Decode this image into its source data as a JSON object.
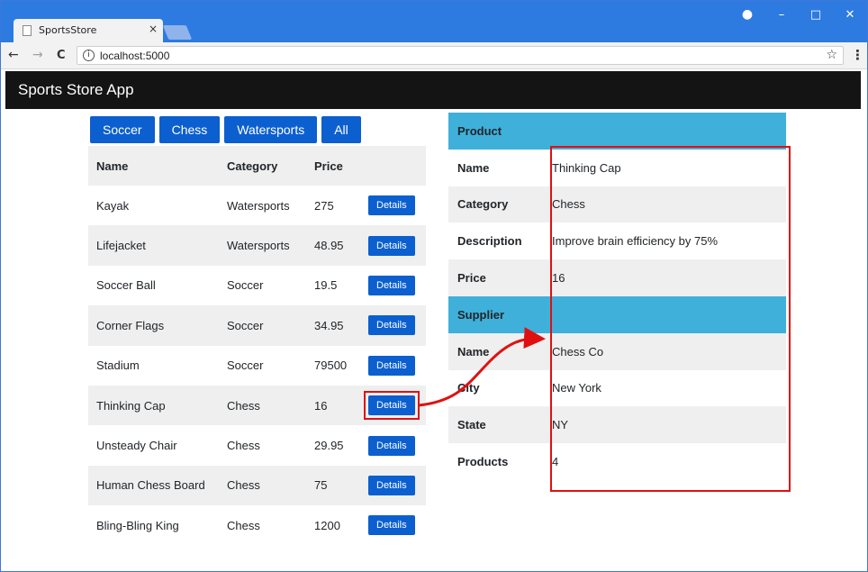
{
  "browser": {
    "tab_title": "SportsStore",
    "tab_close": "×",
    "url": "localhost:5000",
    "controls": {
      "profile": "●",
      "minimize": "–",
      "maximize": "□",
      "close": "✕"
    },
    "nav": {
      "back": "←",
      "forward": "→",
      "reload": "C"
    },
    "info": "i",
    "star": "☆",
    "menu": "⋮"
  },
  "app": {
    "title": "Sports Store App",
    "categories": [
      "Soccer",
      "Chess",
      "Watersports",
      "All"
    ],
    "table": {
      "headers": [
        "Name",
        "Category",
        "Price"
      ],
      "rows": [
        {
          "name": "Kayak",
          "category": "Watersports",
          "price": "275",
          "action": "Details"
        },
        {
          "name": "Lifejacket",
          "category": "Watersports",
          "price": "48.95",
          "action": "Details"
        },
        {
          "name": "Soccer Ball",
          "category": "Soccer",
          "price": "19.5",
          "action": "Details"
        },
        {
          "name": "Corner Flags",
          "category": "Soccer",
          "price": "34.95",
          "action": "Details"
        },
        {
          "name": "Stadium",
          "category": "Soccer",
          "price": "79500",
          "action": "Details"
        },
        {
          "name": "Thinking Cap",
          "category": "Chess",
          "price": "16",
          "action": "Details"
        },
        {
          "name": "Unsteady Chair",
          "category": "Chess",
          "price": "29.95",
          "action": "Details"
        },
        {
          "name": "Human Chess Board",
          "category": "Chess",
          "price": "75",
          "action": "Details"
        },
        {
          "name": "Bling-Bling King",
          "category": "Chess",
          "price": "1200",
          "action": "Details"
        }
      ]
    },
    "details": {
      "product_header": "Product",
      "product": [
        {
          "key": "Name",
          "value": "Thinking Cap"
        },
        {
          "key": "Category",
          "value": "Chess"
        },
        {
          "key": "Description",
          "value": "Improve brain efficiency by 75%"
        },
        {
          "key": "Price",
          "value": "16"
        }
      ],
      "supplier_header": "Supplier",
      "supplier": [
        {
          "key": "Name",
          "value": "Chess Co"
        },
        {
          "key": "City",
          "value": "New York"
        },
        {
          "key": "State",
          "value": "NY"
        },
        {
          "key": "Products",
          "value": "4"
        }
      ]
    },
    "colors": {
      "button": "#0b5fcf",
      "header_band": "#3fb0da",
      "highlight": "#e01010",
      "app_bar": "#141414",
      "titlebar": "#2d7be0"
    }
  }
}
